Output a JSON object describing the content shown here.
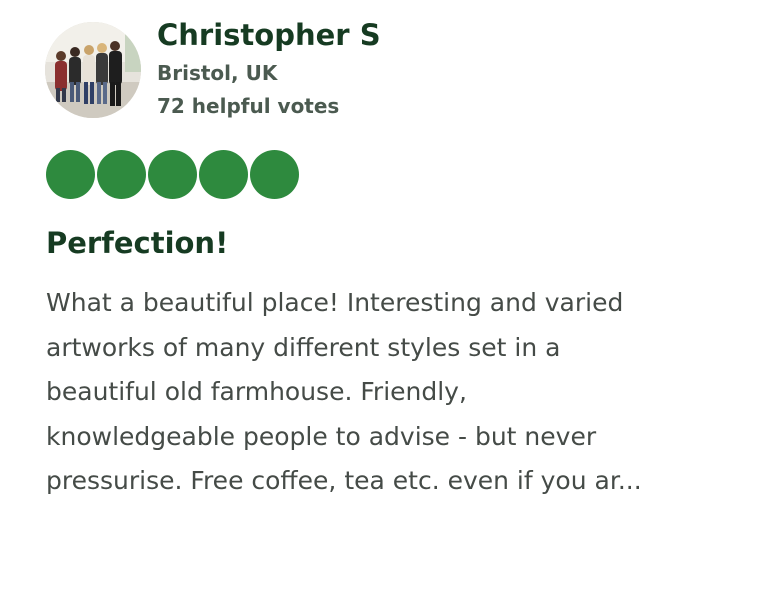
{
  "author": {
    "name": "Christopher S",
    "location": "Bristol, UK",
    "helpful_votes": "72 helpful votes",
    "avatar_icon": "group-photo-avatar"
  },
  "rating": {
    "value": 5,
    "max": 5,
    "bubble_color": "#2e8a3e"
  },
  "review": {
    "title": "Perfection!",
    "body_lines": [
      "What a beautiful place! Interesting and varied",
      "artworks of many different styles set in a",
      "beautiful old farmhouse. Friendly,",
      "knowledgeable people to advise - but never",
      "pressurise. Free coffee, tea etc. even if you ar..."
    ]
  }
}
